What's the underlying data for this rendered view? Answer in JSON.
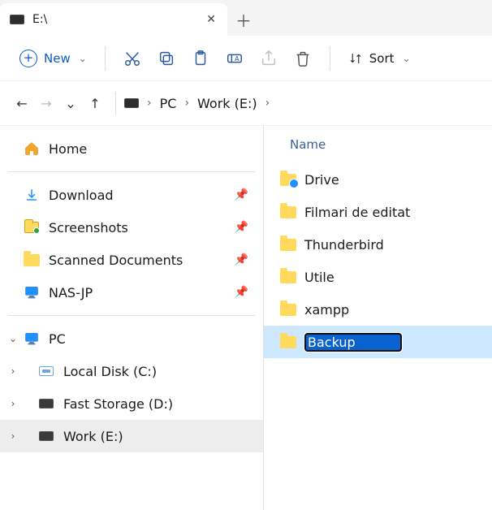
{
  "tab": {
    "title": "E:\\"
  },
  "toolbar": {
    "new_label": "New",
    "sort_label": "Sort"
  },
  "breadcrumb": {
    "pc": "PC",
    "drive": "Work (E:)"
  },
  "nav": {
    "home": "Home",
    "pinned": {
      "download": "Download",
      "screenshots": "Screenshots",
      "scanned": "Scanned Documents",
      "nas": "NAS-JP"
    },
    "pc": "PC",
    "drives": {
      "c": "Local Disk (C:)",
      "d": "Fast Storage (D:)",
      "e": "Work (E:)"
    }
  },
  "header": {
    "name": "Name"
  },
  "items": {
    "drive": "Drive",
    "filmari": "Filmari de editat",
    "thunderbird": "Thunderbird",
    "utile": "Utile",
    "xampp": "xampp",
    "backup": "Backup"
  }
}
